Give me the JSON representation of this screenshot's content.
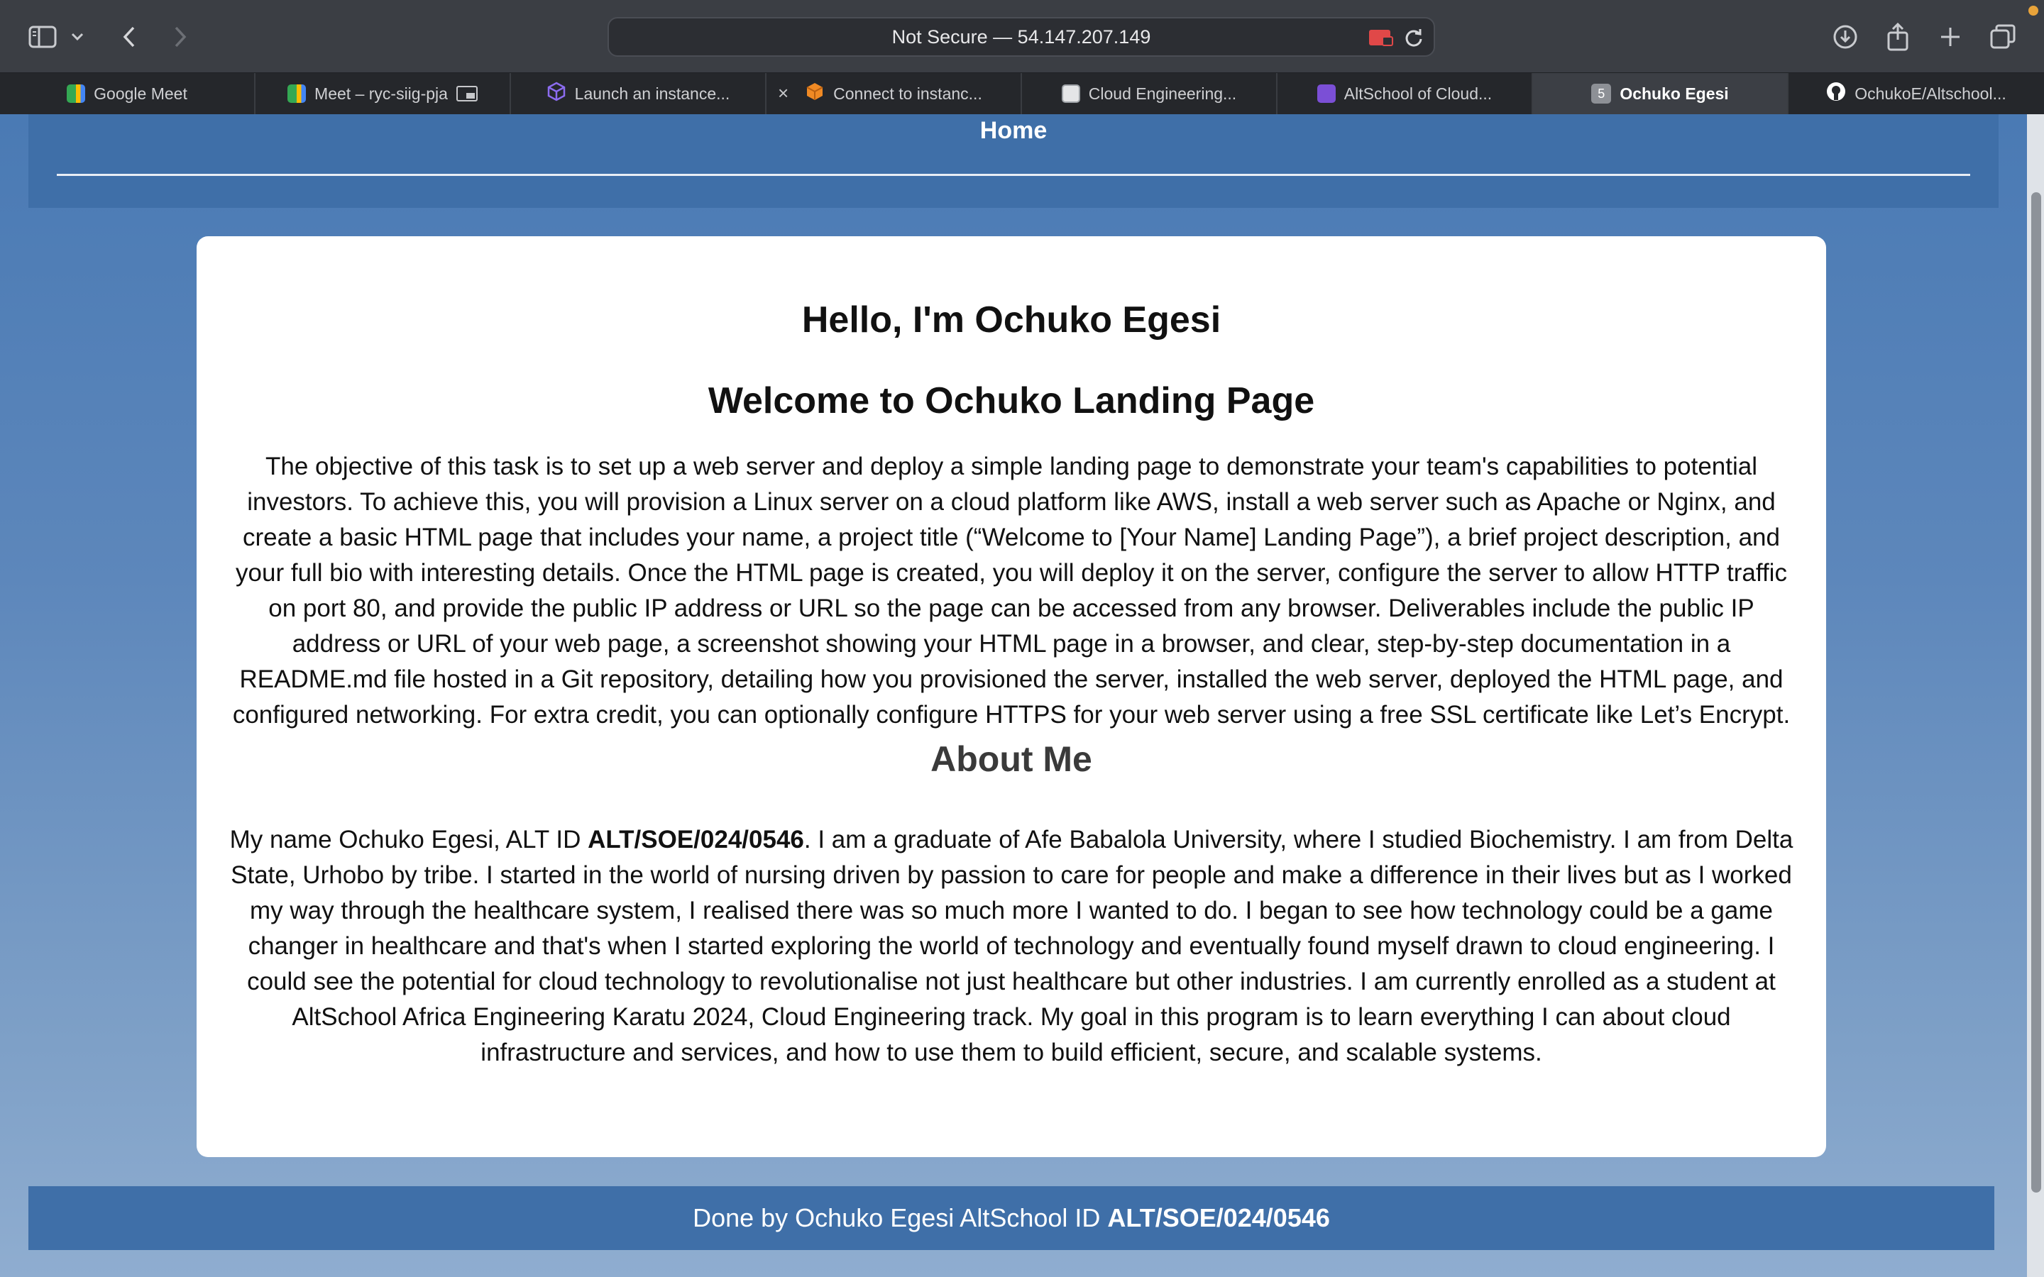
{
  "browser": {
    "address_text": "Not Secure — 54.147.207.149",
    "tabs": [
      {
        "label": "Google Meet",
        "icon": "google-meet-icon",
        "color": "#34a853"
      },
      {
        "label": "Meet – ryc-siig-pja",
        "icon": "google-meet-icon",
        "color": "#34a853"
      },
      {
        "label": "Launch an instance...",
        "icon": "aws-cube-icon",
        "color": "#8c6cf0"
      },
      {
        "label": "Connect to instanc...",
        "icon": "aws-box-icon",
        "color": "#f08a24"
      },
      {
        "label": "Cloud Engineering...",
        "icon": "doc-icon",
        "color": "#9fa3a8"
      },
      {
        "label": "AltSchool of Cloud...",
        "icon": "list-icon",
        "color": "#7b4fd6"
      },
      {
        "label": "Ochuko Egesi",
        "icon": "number-badge",
        "badge": "5"
      },
      {
        "label": "OchukoE/Altschool...",
        "icon": "github-icon",
        "color": "#ffffff"
      }
    ]
  },
  "page": {
    "nav_home": "Home",
    "greeting": "Hello, I'm Ochuko Egesi",
    "welcome": "Welcome to Ochuko Landing Page",
    "objective": "The objective of this task is to set up a web server and deploy a simple landing page to demonstrate your team's capabilities to potential investors. To achieve this, you will provision a Linux server on a cloud platform like AWS, install a web server such as Apache or Nginx, and create a basic HTML page that includes your name, a project title (“Welcome to [Your Name] Landing Page”), a brief project description, and your full bio with interesting details. Once the HTML page is created, you will deploy it on the server, configure the server to allow HTTP traffic on port 80, and provide the public IP address or URL so the page can be accessed from any browser. Deliverables include the public IP address or URL of your web page, a screenshot showing your HTML page in a browser, and clear, step-by-step documentation in a README.md file hosted in a Git repository, detailing how you provisioned the server, installed the web server, deployed the HTML page, and configured networking. For extra credit, you can optionally configure HTTPS for your web server using a free SSL certificate like Let’s Encrypt.",
    "about_heading": "About Me",
    "bio_prefix": "My name Ochuko Egesi, ALT ID ",
    "bio_id": "ALT/SOE/024/0546",
    "bio_rest": ". I am a graduate of Afe Babalola University, where I studied Biochemistry. I am from Delta State, Urhobo by tribe. I started in the world of nursing driven by passion to care for people and make a difference in their lives but as I worked my way through the healthcare system, I realised there was so much more I wanted to do. I began to see how technology could be a game changer in healthcare and that's when I started exploring the world of technology and eventually found myself drawn to cloud engineering. I could see the potential for cloud technology to revolutionalise not just healthcare but other industries. I am currently enrolled as a student at AltSchool Africa Engineering Karatu 2024, Cloud Engineering track. My goal in this program is to learn everything I can about cloud infrastructure and services, and how to use them to build efficient, secure, and scalable systems.",
    "footer_prefix": "Done by Ochuko Egesi AltSchool ID ",
    "footer_id": "ALT/SOE/024/0546"
  },
  "colors": {
    "header": "#3f6fa8",
    "accent_record": "#e04848"
  }
}
